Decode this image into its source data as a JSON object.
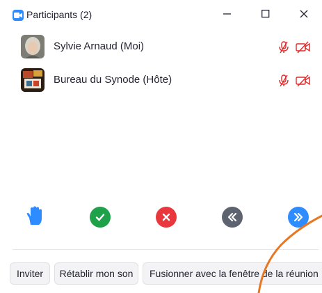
{
  "window": {
    "title": "Participants (2)",
    "controls": [
      "minimize-icon",
      "maximize-icon",
      "close-icon"
    ]
  },
  "participants": [
    {
      "name": "Sylvie Arnaud (Moi)",
      "mic_icon": "mic-muted-icon",
      "video_icon": "video-off-icon"
    },
    {
      "name": "Bureau du Synode (Hôte)",
      "mic_icon": "mic-muted-icon",
      "video_icon": "video-off-icon"
    }
  ],
  "reactions": [
    {
      "icon": "raise-hand-icon",
      "color": "#2D8CFF"
    },
    {
      "icon": "yes-check-icon",
      "color": "#1FA14A"
    },
    {
      "icon": "no-x-icon",
      "color": "#E8383D"
    },
    {
      "icon": "go-slower-icon",
      "color": "#5E6370"
    },
    {
      "icon": "go-faster-icon",
      "color": "#2D8CFF"
    }
  ],
  "footer": {
    "invite_label": "Inviter",
    "unmute_label": "Rétablir mon son",
    "merge_label": "Fusionner avec la fenêtre de la réunion"
  },
  "colors": {
    "accent": "#2D8CFF",
    "muted_red": "#E02828",
    "annotation_orange": "#E87722"
  }
}
